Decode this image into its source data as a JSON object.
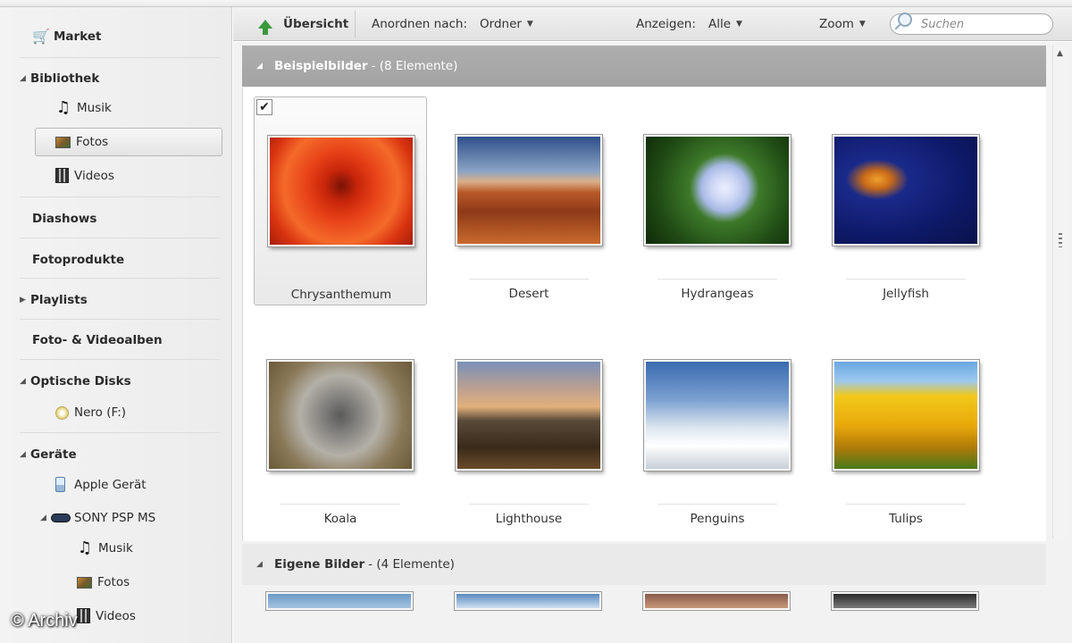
{
  "sidebar": {
    "market": "Market",
    "bibliothek": "Bibliothek",
    "musik": "Musik",
    "fotos": "Fotos",
    "videos": "Videos",
    "diashows": "Diashows",
    "fotoprodukte": "Fotoprodukte",
    "playlists": "Playlists",
    "alben": "Foto- & Videoalben",
    "optische_disks": "Optische Disks",
    "nero": "Nero (F:)",
    "geraete": "Geräte",
    "apple": "Apple Gerät",
    "sony": "SONY PSP MS",
    "sony_musik": "Musik",
    "sony_fotos": "Fotos",
    "sony_videos": "Videos"
  },
  "toolbar": {
    "overview": "Übersicht",
    "arrange_label": "Anordnen nach:",
    "arrange_value": "Ordner",
    "show_label": "Anzeigen:",
    "show_value": "Alle",
    "zoom": "Zoom",
    "search_placeholder": "Suchen"
  },
  "groups": [
    {
      "name": "Beispielbilder",
      "count": "- (8 Elemente)"
    },
    {
      "name": "Eigene Bilder",
      "count": "- (4 Elemente)"
    }
  ],
  "photos": [
    {
      "caption": "Chrysanthemum",
      "selected": true
    },
    {
      "caption": "Desert"
    },
    {
      "caption": "Hydrangeas"
    },
    {
      "caption": "Jellyfish"
    },
    {
      "caption": "Koala"
    },
    {
      "caption": "Lighthouse"
    },
    {
      "caption": "Penguins"
    },
    {
      "caption": "Tulips"
    }
  ],
  "watermark": "© Archiv",
  "colors": {
    "accent_green": "#3a9a3a",
    "group_header": "#a8a8a8",
    "market_red": "#a8202a"
  }
}
